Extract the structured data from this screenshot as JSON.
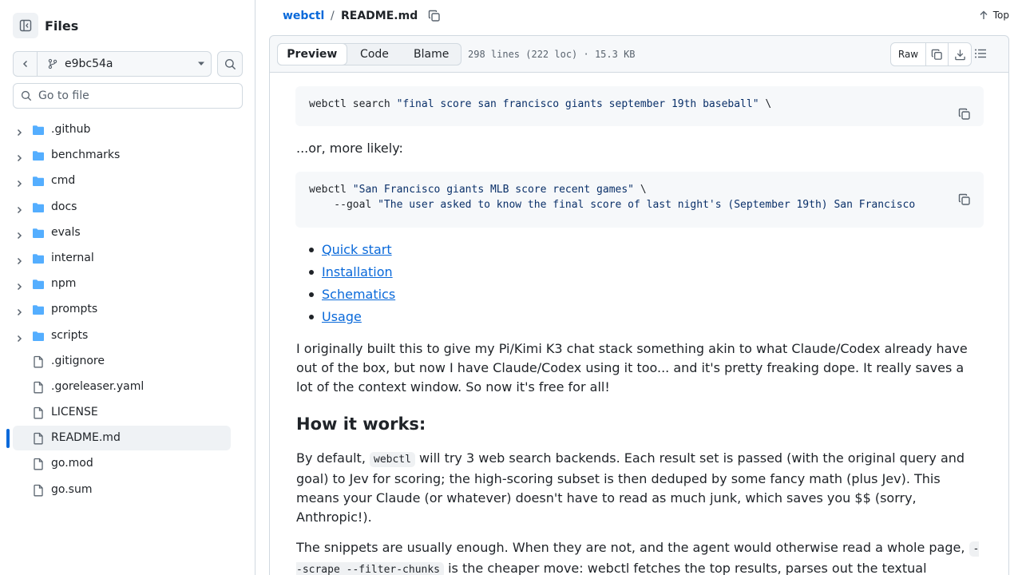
{
  "sidebar": {
    "title": "Files",
    "branch": "e9bc54a",
    "goto_placeholder": "Go to file",
    "items": [
      {
        "label": ".github",
        "type": "folder"
      },
      {
        "label": "benchmarks",
        "type": "folder"
      },
      {
        "label": "cmd",
        "type": "folder"
      },
      {
        "label": "docs",
        "type": "folder"
      },
      {
        "label": "evals",
        "type": "folder"
      },
      {
        "label": "internal",
        "type": "folder"
      },
      {
        "label": "npm",
        "type": "folder"
      },
      {
        "label": "prompts",
        "type": "folder"
      },
      {
        "label": "scripts",
        "type": "folder"
      },
      {
        "label": ".gitignore",
        "type": "file"
      },
      {
        "label": ".goreleaser.yaml",
        "type": "file"
      },
      {
        "label": "LICENSE",
        "type": "file"
      },
      {
        "label": "README.md",
        "type": "file",
        "selected": true
      },
      {
        "label": "go.mod",
        "type": "file"
      },
      {
        "label": "go.sum",
        "type": "file"
      }
    ]
  },
  "header": {
    "repo": "webctl",
    "separator": "/",
    "file": "README.md",
    "top_label": "Top"
  },
  "filebar": {
    "tabs": [
      "Preview",
      "Code",
      "Blame"
    ],
    "active_tab": "Preview",
    "stats": "298 lines (222 loc) · 15.3 KB",
    "raw_label": "Raw"
  },
  "readme": {
    "code1": {
      "cmd": "webctl search ",
      "str": "\"final score san francisco giants september 19th baseball\"",
      "tail": " \\"
    },
    "or_text": "...or, more likely:",
    "code2": {
      "line1_cmd": "webctl ",
      "line1_str": "\"San Francisco giants MLB score recent games\"",
      "line1_tail": " \\",
      "line2_cmd": "    --goal ",
      "line2_str": "\"The user asked to know the final score of last night's (September 19th) San Francisco"
    },
    "links": [
      "Quick start",
      "Installation",
      "Schematics",
      "Usage"
    ],
    "para1": "I originally built this to give my Pi/Kimi K3 chat stack something akin to what Claude/Codex already have out of the box, but now I have Claude/Codex using it too... and it's pretty freaking dope. It really saves a lot of the context window. So now it's free for all!",
    "heading": "How it works:",
    "para2_a": "By default, ",
    "para2_code": "webctl",
    "para2_b": " will try 3 web search backends. Each result set is passed (with the original query and goal) to Jev for scoring; the high-scoring subset is then deduped by some fancy math (plus Jev). This means your Claude (or whatever) doesn't have to read as much junk, which saves you $$ (sorry, Anthropic!).",
    "para3_a": "The snippets are usually enough. When they are not, and the agent would otherwise read a whole page, ",
    "para3_code": "--scrape --filter-chunks",
    "para3_b": " is the cheaper move: webctl fetches the top results, parses out the textual"
  },
  "colors": {
    "accent": "#0969da",
    "folder": "#54aeff",
    "border": "#d1d9e0"
  }
}
